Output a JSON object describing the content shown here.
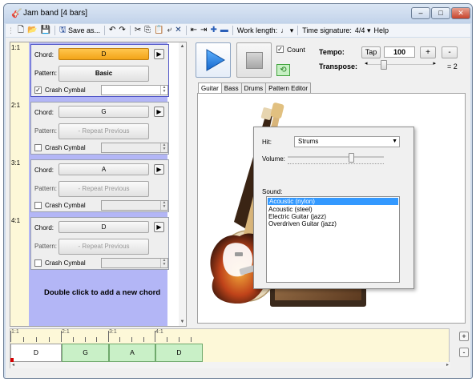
{
  "window": {
    "title": "Jam band [4 bars]",
    "min": "–",
    "max": "□",
    "close": "✕"
  },
  "toolbar": {
    "save_as": "Save as...",
    "work_length_label": "Work length:",
    "work_length_value": "♩",
    "time_sig_label": "Time signature:",
    "time_sig_value": "4/4",
    "help": "Help"
  },
  "chords": [
    {
      "num": "1:1",
      "chord": "D",
      "pattern": "Basic",
      "crash": true
    },
    {
      "num": "2:1",
      "chord": "G",
      "pattern": "- Repeat Previous",
      "crash": false
    },
    {
      "num": "3:1",
      "chord": "A",
      "pattern": "- Repeat Previous",
      "crash": false
    },
    {
      "num": "4:1",
      "chord": "D",
      "pattern": "- Repeat Previous",
      "crash": false
    }
  ],
  "labels": {
    "chord": "Chord:",
    "pattern": "Pattern:",
    "crash": "Crash Cymbal",
    "add_hint": "Double click to add a new chord"
  },
  "transport": {
    "count_label": "Count",
    "count_checked": true,
    "tempo_label": "Tempo:",
    "tap": "Tap",
    "tempo_value": "100",
    "plus": "+",
    "minus": "-",
    "transpose_label": "Transpose:",
    "transpose_value": "= 2"
  },
  "tabs": [
    "Guitar",
    "Bass",
    "Drums",
    "Pattern Editor"
  ],
  "guitar": {
    "hit_label": "Hit:",
    "hit_value": "Strums",
    "volume_label": "Volume:",
    "sound_label": "Sound:",
    "sounds": [
      "Acoustic (nylon)",
      "Acoustic (steel)",
      "Electric Guitar (jazz)",
      "Overdriven Guitar (jazz)"
    ],
    "selected_sound": "Acoustic (nylon)"
  },
  "timeline": {
    "markers": [
      "1:1",
      "2:1",
      "3:1",
      "4:1"
    ],
    "blocks": [
      "D",
      "G",
      "A",
      "D"
    ]
  },
  "zoom": {
    "in": "+",
    "out": "-"
  },
  "colors": {
    "accent_orange": "#f7b22b",
    "lavender": "#b3b6f6",
    "timeline_bg": "#fdf8d8",
    "block_green": "#c9f0c7"
  }
}
